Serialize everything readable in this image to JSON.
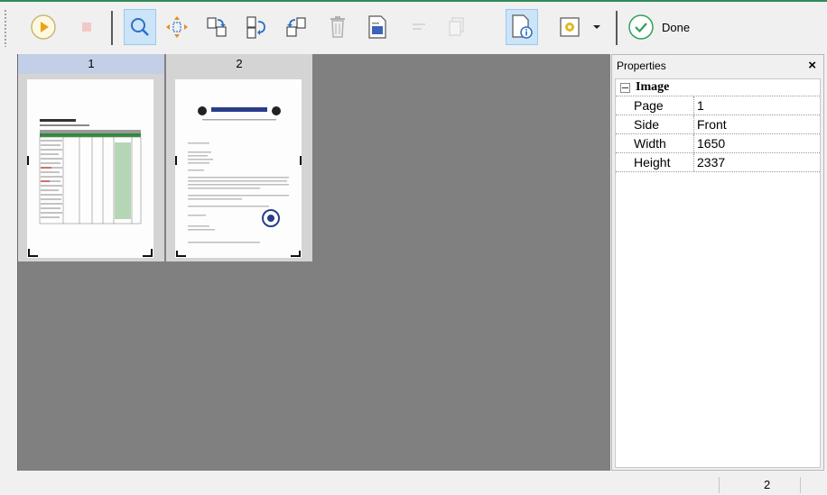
{
  "toolbar": {
    "buttons": [
      {
        "name": "play-icon",
        "active": false
      },
      {
        "name": "stop-icon",
        "active": false
      },
      {
        "name": "magnifier-icon",
        "active": true
      },
      {
        "name": "move-icon",
        "active": false
      },
      {
        "name": "rotate-right-icon",
        "active": false
      },
      {
        "name": "flip-icon",
        "active": false
      },
      {
        "name": "rotate-left-icon",
        "active": false
      },
      {
        "name": "trash-icon",
        "active": false
      },
      {
        "name": "scan-page-icon",
        "active": false
      },
      {
        "name": "page-info-icon",
        "active": true
      },
      {
        "name": "settings-icon",
        "active": false
      }
    ],
    "done_label": "Done"
  },
  "pages": [
    {
      "number": "1",
      "selected": true
    },
    {
      "number": "2",
      "selected": false
    }
  ],
  "properties": {
    "title": "Properties",
    "close_label": "×",
    "category": "Image",
    "rows": [
      {
        "key": "Page",
        "value": "1"
      },
      {
        "key": "Side",
        "value": "Front"
      },
      {
        "key": "Width",
        "value": "1650"
      },
      {
        "key": "Height",
        "value": "2337"
      }
    ]
  },
  "status": {
    "page_count": "2"
  }
}
